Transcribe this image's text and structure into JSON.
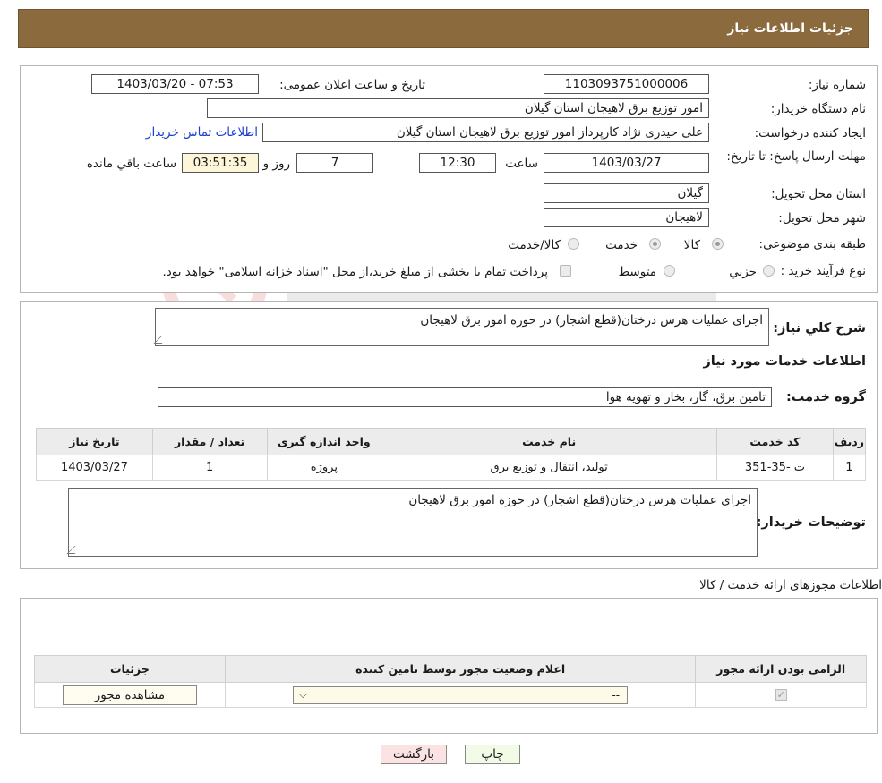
{
  "header": {
    "title": "جزئیات اطلاعات نیاز"
  },
  "info": {
    "need_number_label": "شماره نیاز:",
    "need_number": "1103093751000006",
    "announce_label": "تاریخ و ساعت اعلان عمومی:",
    "announce_value": "1403/03/20 - 07:53",
    "buyer_org_label": "نام دستگاه خریدار:",
    "buyer_org": "امور توزیع برق لاهیجان استان گیلان",
    "creator_label": "ایجاد کننده درخواست:",
    "creator": "علی حیدری نژاد کارپرداز امور توزیع برق لاهیجان استان گیلان",
    "contact_link": "اطلاعات تماس خریدار",
    "deadline_label": "مهلت ارسال پاسخ: تا تاریخ:",
    "deadline_date": "1403/03/27",
    "time_label": "ساعت",
    "deadline_time": "12:30",
    "days_value": "7",
    "days_label": "روز و",
    "remaining_value": "03:51:35",
    "remaining_label": "ساعت باقي مانده",
    "province_label": "استان محل تحویل:",
    "province": "گیلان",
    "city_label": "شهر محل تحویل:",
    "city": "لاهیجان",
    "category_label": "طبقه بندی موضوعی:",
    "category_options": [
      "کالا",
      "خدمت",
      "کالا/خدمت"
    ],
    "process_label": "نوع فرآیند خرید :",
    "process_options": [
      "جزیي",
      "متوسط"
    ],
    "payment_note": "پرداخت تمام یا بخشی از مبلغ خرید،از محل \"اسناد خزانه اسلامی\" خواهد بود."
  },
  "summary": {
    "label": "شرح کلي نياز:",
    "text": "اجرای عملیات هرس درختان(قطع اشجار) در حوزه امور برق لاهیجان",
    "services_title": "اطلاعات خدمات مورد نیاز",
    "group_label": "گروه خدمت:",
    "group_value": "تامین برق، گاز، بخار و تهویه هوا"
  },
  "services_table": {
    "headers": [
      "ردیف",
      "کد خدمت",
      "نام خدمت",
      "واحد اندازه گیری",
      "تعداد / مقدار",
      "تاریخ نیاز"
    ],
    "rows": [
      [
        "1",
        "ت -35-351",
        "تولید، انتقال و توزیع برق",
        "پروژه",
        "1",
        "1403/03/27"
      ]
    ]
  },
  "buyer_notes": {
    "label": "توضیحات خریدار:",
    "text": "اجرای عملیات هرس درختان(قطع اشجار) در حوزه امور برق لاهیجان"
  },
  "permits": {
    "title": "اطلاعات مجوزهای ارائه خدمت / کالا",
    "headers": [
      "الزامی بودن ارائه مجوز",
      "اعلام وضعیت مجوز توسط تامین کننده",
      "جزئیات"
    ],
    "select_value": "--",
    "view_button": "مشاهده مجوز"
  },
  "footer": {
    "back_button": "بازگشت",
    "print_button": "چاپ"
  },
  "colors": {
    "header_bg": "#8b6a3e",
    "back_bg": "#fbe3e3",
    "print_bg": "#f1fbe6"
  }
}
